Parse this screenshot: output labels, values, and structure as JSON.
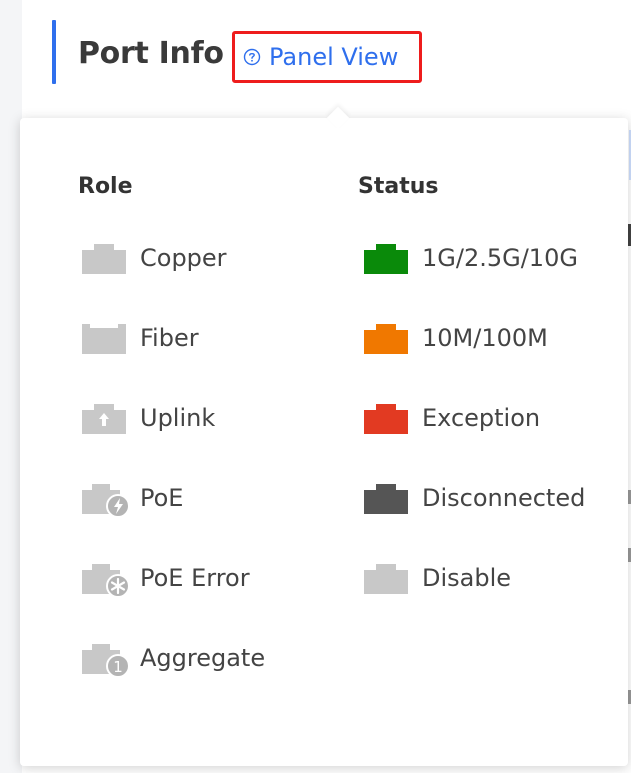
{
  "header": {
    "title": "Port Info",
    "panel_view_label": "Panel View",
    "panel_view_icon": "help-circle-icon"
  },
  "legend": {
    "role": {
      "heading": "Role",
      "items": [
        {
          "label": "Copper",
          "icon": "copper-port-icon",
          "color": "#c8c8c8"
        },
        {
          "label": "Fiber",
          "icon": "fiber-port-icon",
          "color": "#c8c8c8"
        },
        {
          "label": "Uplink",
          "icon": "uplink-port-icon",
          "color": "#c8c8c8"
        },
        {
          "label": "PoE",
          "icon": "poe-port-icon",
          "color": "#c8c8c8"
        },
        {
          "label": "PoE Error",
          "icon": "poe-error-port-icon",
          "color": "#c8c8c8"
        },
        {
          "label": "Aggregate",
          "icon": "aggregate-port-icon",
          "color": "#c8c8c8",
          "badge": "1"
        }
      ]
    },
    "status": {
      "heading": "Status",
      "items": [
        {
          "label": "1G/2.5G/10G",
          "icon": "port-status-icon",
          "color": "#0a8a0a"
        },
        {
          "label": "10M/100M",
          "icon": "port-status-icon",
          "color": "#f07800"
        },
        {
          "label": "Exception",
          "icon": "port-status-icon",
          "color": "#e23a22"
        },
        {
          "label": "Disconnected",
          "icon": "port-status-icon",
          "color": "#555555"
        },
        {
          "label": "Disable",
          "icon": "port-status-icon",
          "color": "#c8c8c8"
        }
      ]
    }
  },
  "colors": {
    "accent": "#2f6fed",
    "highlight_border": "#ee1c1c"
  }
}
